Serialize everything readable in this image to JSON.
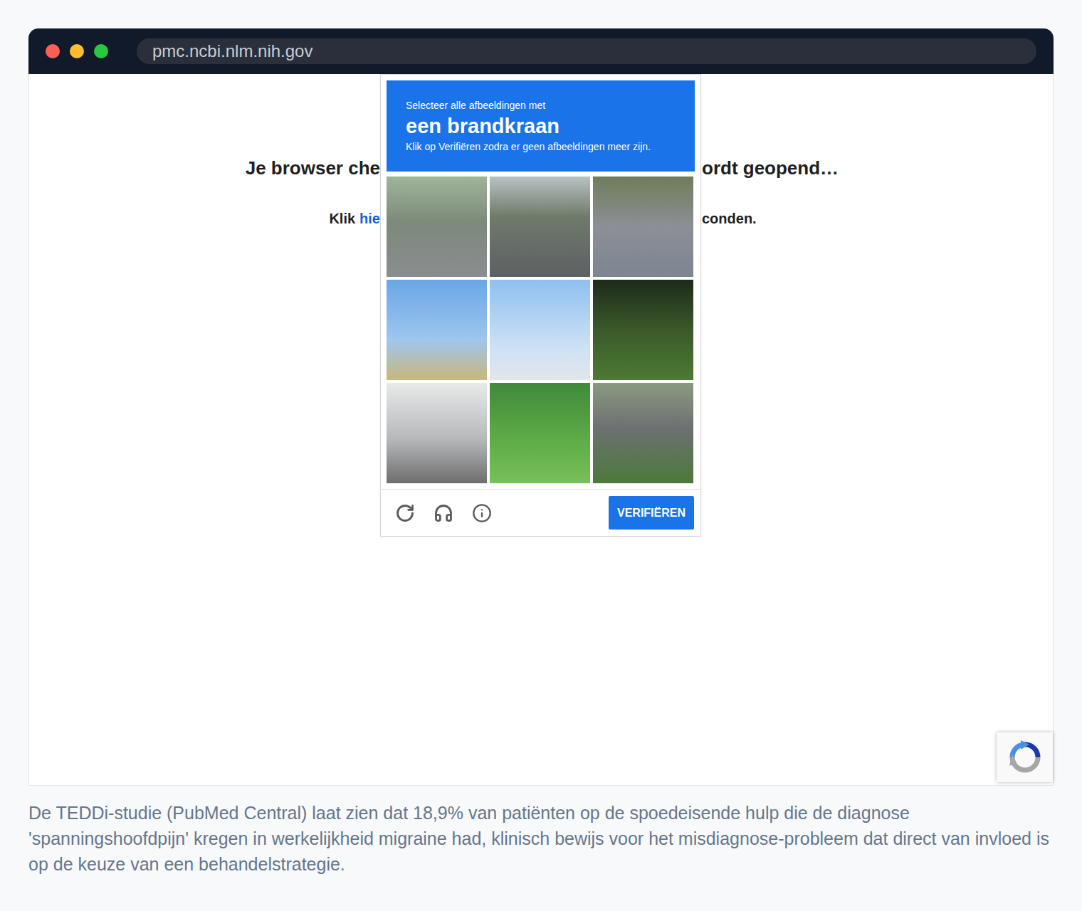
{
  "browser": {
    "url": "pmc.ncbi.nlm.nih.gov"
  },
  "page": {
    "heading_left": "Je browser che",
    "heading_right": "ordt geopend…",
    "line_left": "Klik",
    "link": "hie",
    "line_right": "conden."
  },
  "captcha": {
    "prompt": "Selecteer alle afbeeldingen met",
    "target": "een brandkraan",
    "instruction": "Klik op Verifiëren zodra er geen afbeeldingen meer zijn.",
    "tiles": [
      {
        "selected": false
      },
      {
        "selected": false
      },
      {
        "selected": false
      },
      {
        "selected": false
      },
      {
        "selected": false
      },
      {
        "selected": false
      },
      {
        "selected": false
      },
      {
        "selected": false
      },
      {
        "selected": false
      }
    ],
    "button": "VERIFIËREN"
  },
  "caption": "De TEDDi-studie (PubMed Central) laat zien dat 18,9% van patiënten op de spoedeisende hulp die de diagnose 'spanningshoofdpijn' kregen in werkelijkheid migraine had, klinisch bewijs voor het misdiagnose-probleem dat direct van invloed is op de keuze van een behandelstrategie."
}
